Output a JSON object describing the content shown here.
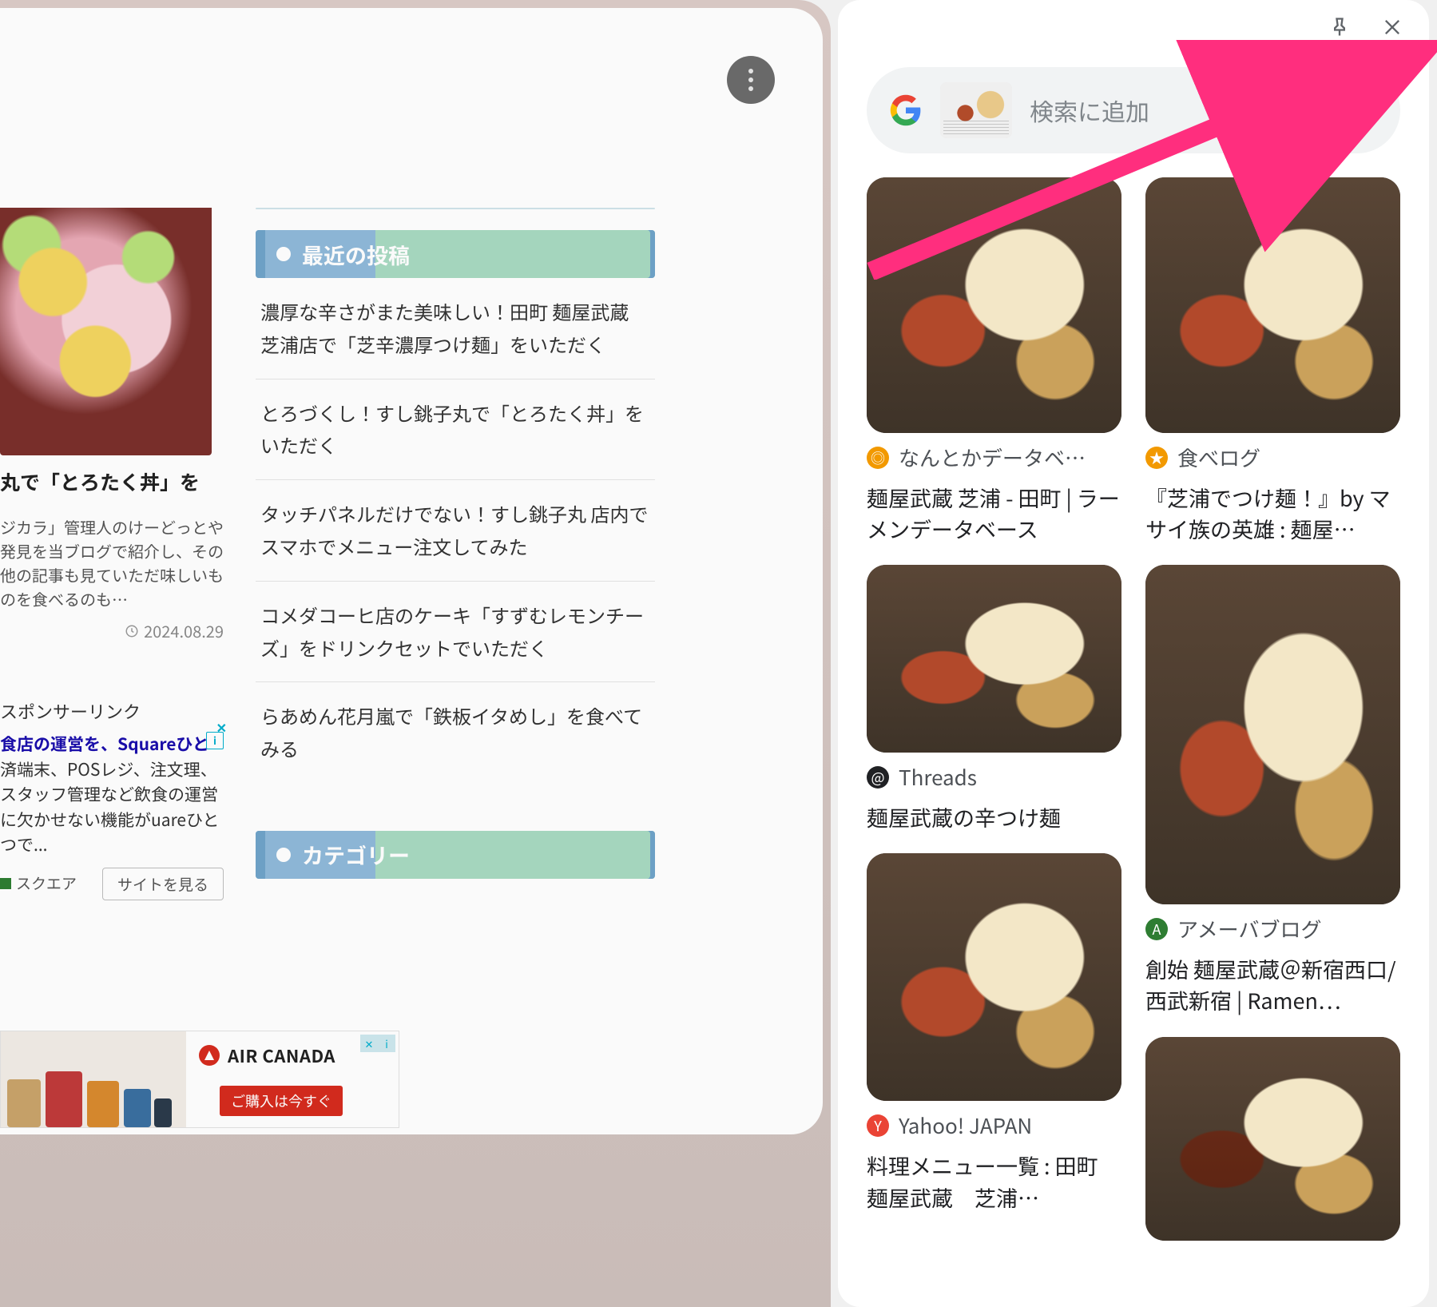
{
  "left": {
    "article": {
      "title": "丸で「とろたく丼」を",
      "desc": "ジカラ」管理人のけーどっとや発見を当ブログで紹介し、その他の記事も見ていただ味しいものを食べるのも…",
      "date": "2024.08.29"
    },
    "sponsor_heading": "スポンサーリンク",
    "ad": {
      "headline": "食店の運営を、Squareひと",
      "body": "済端末、POSレジ、注文理、スタッフ管理など飲食の運営に欠かせない機能がuareひとつで...",
      "source": "スクエア",
      "cta": "サイトを見る"
    },
    "widgets": {
      "recent_title": "最近の投稿",
      "category_title": "カテゴリー",
      "posts": [
        "濃厚な辛さがまた美味しい！田町 麺屋武蔵 芝浦店で「芝辛濃厚つけ麺」をいただく",
        "とろづくし！すし銚子丸で「とろたく丼」をいただく",
        "タッチパネルだけでない！すし銚子丸 店内でスマホでメニュー注文してみた",
        "コメダコーヒ店のケーキ「すずむレモンチーズ」をドリンクセットでいただく",
        "らあめん花月嵐で「鉄板イタめし」を食べてみる"
      ]
    },
    "banner": {
      "brand": "AIR CANADA",
      "cta": "ご購入は今すぐ"
    }
  },
  "lens": {
    "search_placeholder": "検索に追加",
    "results": [
      {
        "source": "なんとかデータベ…",
        "fav": "orange",
        "title": "麺屋武蔵 芝浦 - 田町 | ラーメンデータベース",
        "h": "h-320",
        "style": ""
      },
      {
        "source": "食べログ",
        "fav": "orange",
        "title": "『芝浦でつけ麺！』by マサイ族の英雄 : 麺屋…",
        "h": "h-320",
        "style": ""
      },
      {
        "source": "Threads",
        "fav": "gray",
        "title": "麺屋武蔵の辛つけ麺",
        "h": "h-235",
        "style": ""
      },
      {
        "source": "アメーバブログ",
        "fav": "green2",
        "title": "創始 麺屋武蔵＠新宿西口/西武新宿 | Ramen…",
        "h": "h-425",
        "style": ""
      },
      {
        "source": "Yahoo! JAPAN",
        "fav": "red",
        "title": "料理メニュー一覧 : 田町　麺屋武蔵　芝浦…",
        "h": "h-310",
        "style": ""
      },
      {
        "source": "",
        "fav": "",
        "title": "",
        "h": "h-255",
        "style": "noodle"
      }
    ]
  }
}
